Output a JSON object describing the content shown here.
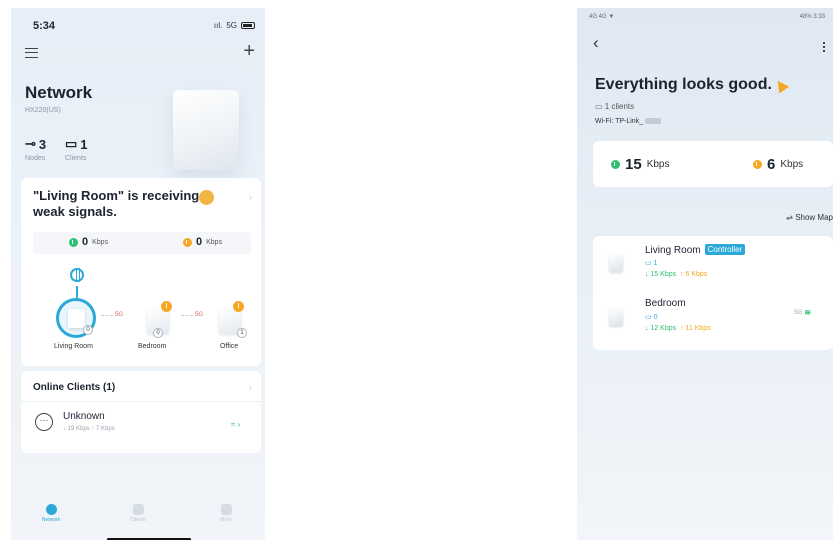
{
  "left": {
    "status": {
      "time": "5:34",
      "network": "5G"
    },
    "header": {
      "title": "Network",
      "model": "HX220(US)"
    },
    "stats": {
      "nodes": {
        "value": "3",
        "label": "Nodes"
      },
      "clients": {
        "value": "1",
        "label": "Clients"
      }
    },
    "alert": {
      "message": "\"Living Room\" is receiving weak signals.",
      "download": {
        "value": "0",
        "unit": "Kbps"
      },
      "upload": {
        "value": "0",
        "unit": "Kbps"
      }
    },
    "topology": {
      "nodes": [
        {
          "name": "Living Room",
          "clients": "0",
          "warning": ""
        },
        {
          "name": "Bedroom",
          "clients": "0",
          "warning": "!"
        },
        {
          "name": "Office",
          "clients": "1",
          "warning": "!"
        }
      ],
      "links": [
        "5G",
        "5G"
      ]
    },
    "clients_card": {
      "title": "Online Clients (1)",
      "client": {
        "name": "Unknown",
        "speed": "↓ 19 Kbps ↑ 7 Kbps"
      }
    },
    "tabs": [
      {
        "label": "Network",
        "active": true
      },
      {
        "label": "Clients",
        "active": false
      },
      {
        "label": "More",
        "active": false
      }
    ]
  },
  "right": {
    "status": {
      "left": "4G 4G ▼",
      "right": "48% 3:33"
    },
    "title": "Everything looks good.",
    "clients": "1 clients",
    "wifi": "Wi-Fi: TP-Link_",
    "download": {
      "value": "15",
      "unit": "Kbps"
    },
    "upload": {
      "value": "6",
      "unit": "Kbps"
    },
    "show_map": "⇌ Show Map",
    "devices": [
      {
        "name": "Living Room",
        "badge": "Controller",
        "clients": "1",
        "speed_down": "↓ 15 Kbps",
        "speed_up": "↑ 6 Kbps",
        "band": ""
      },
      {
        "name": "Bedroom",
        "badge": "",
        "clients": "0",
        "speed_down": "↓ 12 Kbps",
        "speed_up": "↑ 11 Kbps",
        "band": "5G"
      }
    ]
  },
  "colors": {
    "accent": "#2aa9d9",
    "download": "#2fbf71",
    "upload": "#f5a623",
    "warning": "#f5a623"
  }
}
